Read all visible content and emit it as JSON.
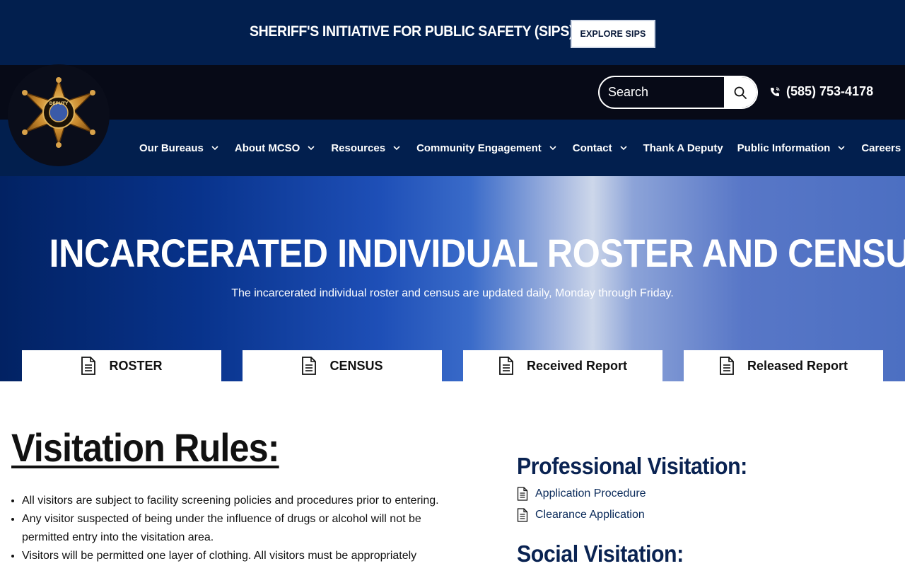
{
  "topbar": {
    "title": "SHERIFF'S INITIATIVE FOR PUBLIC SAFETY (SIPS)",
    "button_label": "EXPLORE SIPS"
  },
  "header": {
    "logo_icon": "sheriff-star-badge-icon",
    "logo_text": "DEPUTY",
    "search": {
      "placeholder": "Search",
      "value": ""
    },
    "phone": "(585) 753-4178"
  },
  "nav": {
    "items": [
      {
        "label": "Our Bureaus",
        "has_dropdown": true
      },
      {
        "label": "About MCSO",
        "has_dropdown": true
      },
      {
        "label": "Resources",
        "has_dropdown": true
      },
      {
        "label": "Community Engagement",
        "has_dropdown": true
      },
      {
        "label": "Contact",
        "has_dropdown": true
      },
      {
        "label": "Thank A Deputy",
        "has_dropdown": false
      },
      {
        "label": "Public Information",
        "has_dropdown": true
      },
      {
        "label": "Careers",
        "has_dropdown": false
      }
    ]
  },
  "hero": {
    "title": "INCARCERATED INDIVIDUAL ROSTER AND CENSUS",
    "subtitle": "The incarcerated individual roster and census are updated daily, Monday through Friday.",
    "tabs": [
      {
        "label": "ROSTER",
        "icon": "document-icon"
      },
      {
        "label": "CENSUS",
        "icon": "document-icon"
      },
      {
        "label": "Received Report",
        "icon": "document-icon"
      },
      {
        "label": "Released Report",
        "icon": "document-icon"
      }
    ]
  },
  "visitation": {
    "title": "Visitation Rules:",
    "rules": [
      "All visitors are subject to facility screening policies and procedures prior to entering.",
      "Any visitor suspected of being under the influence of drugs or alcohol will not be permitted entry into the visitation area.",
      "Visitors will be permitted one layer of clothing. All visitors must be appropriately"
    ]
  },
  "professional": {
    "title": "Professional Visitation:",
    "links": [
      {
        "label": "Application Procedure",
        "icon": "document-icon"
      },
      {
        "label": "Clearance Application",
        "icon": "document-icon"
      }
    ]
  },
  "social": {
    "title": "Social Visitation:"
  },
  "colors": {
    "navy": "#021f4e",
    "header_black": "#070a17",
    "heading_blue": "#0a2352"
  }
}
